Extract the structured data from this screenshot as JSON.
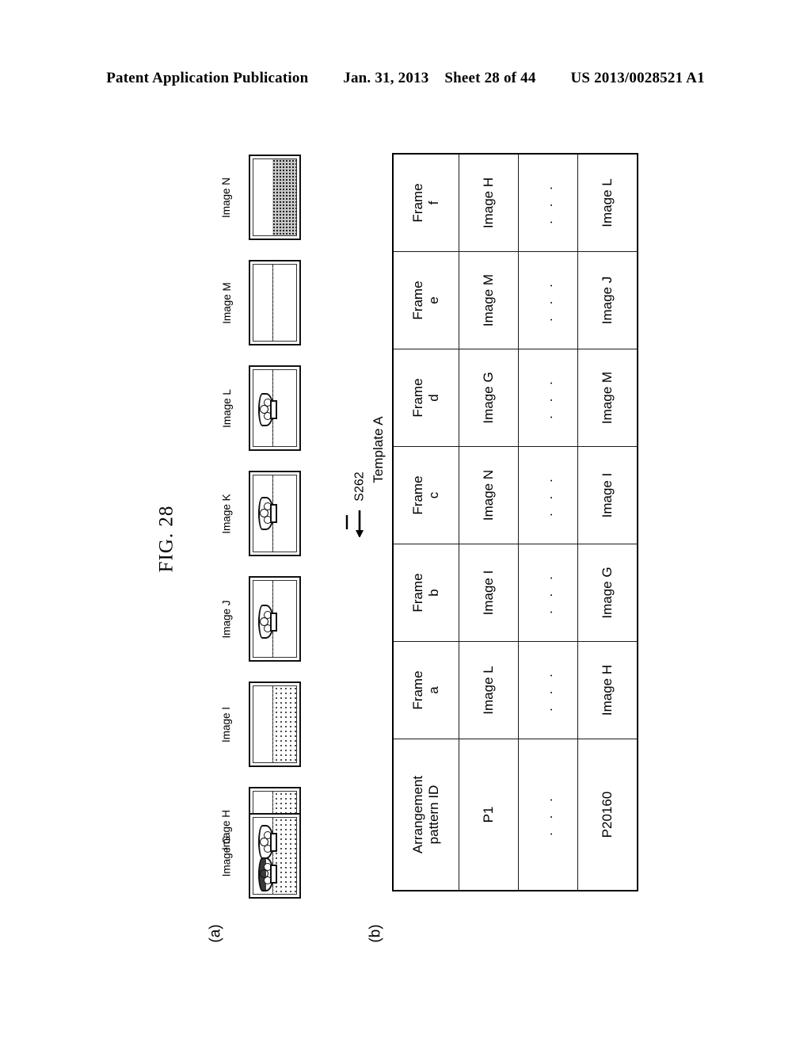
{
  "header": {
    "publication": "Patent Application Publication",
    "date": "Jan. 31, 2013",
    "sheet": "Sheet 28 of 44",
    "docnum": "US 2013/0028521 A1"
  },
  "figure": {
    "label": "FIG. 28",
    "part_a_label": "(a)",
    "part_b_label": "(b)",
    "step_label": "S262",
    "arrow_icon": "arrow-right-icon"
  },
  "part_a": {
    "caption": "image strip",
    "items": [
      {
        "label": "Image G",
        "content": "two-people-on-dotted-ground"
      },
      {
        "label": "Image H",
        "content": "one-person-on-dotted-ground"
      },
      {
        "label": "Image I",
        "content": "dotted-ground-no-person"
      },
      {
        "label": "Image J",
        "content": "one-person-plain-ground"
      },
      {
        "label": "Image K",
        "content": "one-person-plain-ground"
      },
      {
        "label": "Image L",
        "content": "one-person-plain-ground"
      },
      {
        "label": "Image M",
        "content": "plain-horizon-no-person"
      },
      {
        "label": "Image N",
        "content": "dense-textured-ground"
      }
    ]
  },
  "part_b": {
    "template_header": "Template A",
    "id_column_header_line1": "Arrangement",
    "id_column_header_line2": "pattern ID",
    "frame_word": "Frame",
    "frame_letters": [
      "a",
      "b",
      "c",
      "d",
      "e",
      "f"
    ],
    "ellipsis": ". . .",
    "rows": [
      {
        "id": "P1",
        "cells": [
          "Image L",
          "Image I",
          "Image N",
          "Image G",
          "Image M",
          "Image H"
        ]
      },
      {
        "id": ". . .",
        "cells": [
          ". . .",
          ". . .",
          ". . .",
          ". . .",
          ". . .",
          ". . ."
        ]
      },
      {
        "id": "P20160",
        "cells": [
          "Image H",
          "Image G",
          "Image I",
          "Image M",
          "Image J",
          "Image L"
        ]
      }
    ]
  }
}
